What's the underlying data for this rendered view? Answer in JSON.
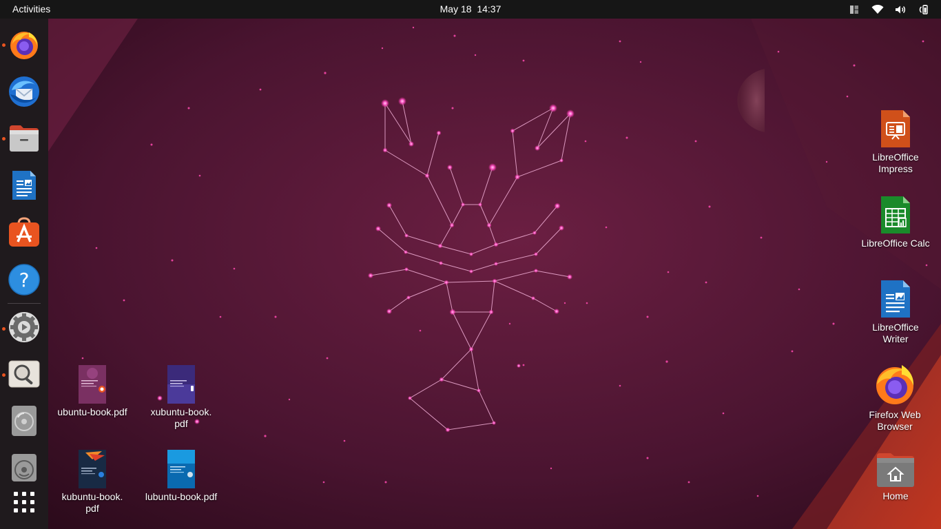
{
  "topbar": {
    "activities": "Activities",
    "date": "May 18",
    "time": "14:37",
    "tray_icons": [
      "window-layout-icon",
      "wifi-icon",
      "volume-icon",
      "battery-icon"
    ]
  },
  "dock": {
    "items": [
      {
        "name": "Firefox",
        "icon": "firefox-icon",
        "running": true
      },
      {
        "name": "Thunderbird Mail",
        "icon": "thunderbird-icon",
        "running": false
      },
      {
        "name": "Files",
        "icon": "files-icon",
        "running": true
      },
      {
        "name": "LibreOffice Writer",
        "icon": "writer-icon",
        "running": false
      },
      {
        "name": "Ubuntu Software",
        "icon": "software-store-icon",
        "running": false
      },
      {
        "name": "Help",
        "icon": "help-icon",
        "running": false
      },
      {
        "name": "Settings",
        "icon": "settings-icon",
        "running": true
      },
      {
        "name": "Screenshot",
        "icon": "screenshot-icon",
        "running": true
      },
      {
        "name": "Disc 1",
        "icon": "disc-icon",
        "running": false
      },
      {
        "name": "Disc 2",
        "icon": "disc-icon",
        "running": false
      },
      {
        "name": "Show Applications",
        "icon": "app-grid-icon",
        "running": false
      }
    ]
  },
  "desktop": {
    "left_icons": [
      {
        "label": "ubuntu-book.pdf"
      },
      {
        "label": "xubuntu-book.\npdf"
      },
      {
        "label": "kubuntu-book.\npdf"
      },
      {
        "label": "lubuntu-book.pdf"
      }
    ],
    "right_icons": [
      {
        "label": "LibreOffice\nImpress"
      },
      {
        "label": "LibreOffice Calc"
      },
      {
        "label": "LibreOffice\nWriter"
      },
      {
        "label": "Firefox Web\nBrowser"
      },
      {
        "label": "Home"
      }
    ]
  },
  "colors": {
    "accent": "#e95420",
    "topbar": "#161616",
    "dock": "#1f1a1d",
    "wallpaper_base": "#5e1a38"
  }
}
